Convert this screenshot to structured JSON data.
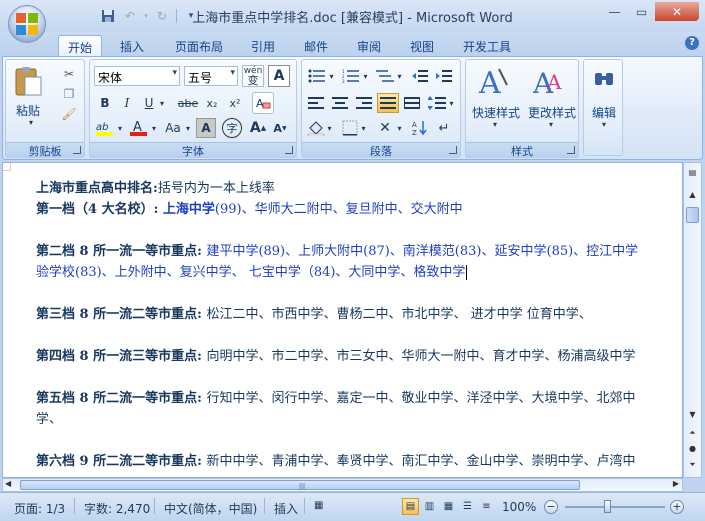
{
  "window": {
    "title": "上海市重点中学排名.doc [兼容模式] - Microsoft Word"
  },
  "tabs": [
    "开始",
    "插入",
    "页面布局",
    "引用",
    "邮件",
    "审阅",
    "视图",
    "开发工具"
  ],
  "ribbon": {
    "clipboard": {
      "group_label": "剪贴板",
      "paste_label": "粘贴"
    },
    "font": {
      "group_label": "字体",
      "font_name": "宋体",
      "font_size": "五号",
      "wen_button": "wén\n变",
      "bold": "B",
      "italic": "I",
      "underline": "U",
      "strikethrough": "abe",
      "subscript": "x₂",
      "superscript": "x²",
      "grow": "A",
      "shrink": "A",
      "char_border": "A",
      "enclose": "字",
      "change_case": "Aa",
      "font_color": "A",
      "highlight": "ab"
    },
    "paragraph": {
      "group_label": "段落"
    },
    "styles": {
      "group_label": "样式",
      "quick_styles": "快速样式",
      "change_styles": "更改样式"
    },
    "editing": {
      "label": "编辑"
    }
  },
  "document": {
    "lines": [
      {
        "parts": [
          {
            "t": "上海市重点高中排名:",
            "s": "bold"
          },
          {
            "t": "括号内为一本上线率",
            "s": "plain"
          }
        ]
      },
      {
        "parts": [
          {
            "t": "第一档（4 大名校）: ",
            "s": "bold"
          },
          {
            "t": "上海中学",
            "s": "blue bold"
          },
          {
            "t": "(99)、华师大二附中、复旦附中、交大附中",
            "s": "blue"
          }
        ]
      },
      {
        "parts": []
      },
      {
        "parts": [
          {
            "t": "第二档 8 所一流一等市重点: ",
            "s": "bold"
          },
          {
            "t": "建平中学(89)、上师大附中(87)、南洋模范(83)、延安中学(85)、控江中学",
            "s": "blue"
          }
        ]
      },
      {
        "parts": [
          {
            "t": "验学校(83)、上外附中、复兴中学、 七宝中学（84)、大同中学、格致中学",
            "s": "blue"
          }
        ]
      },
      {
        "parts": []
      },
      {
        "parts": [
          {
            "t": "第三档 8 所一流二等市重点: ",
            "s": "bold"
          },
          {
            "t": "松江二中、市西中学、曹杨二中、市北中学、 进才中学 位育中学、",
            "s": "plain"
          }
        ]
      },
      {
        "parts": []
      },
      {
        "parts": [
          {
            "t": "第四档 8 所一流三等市重点: ",
            "s": "bold"
          },
          {
            "t": "向明中学、市二中学、市三女中、华师大一附中、育才中学、杨浦高级中学",
            "s": "plain"
          }
        ]
      },
      {
        "parts": []
      },
      {
        "parts": [
          {
            "t": "第五档 8 所二流一等市重点: ",
            "s": "bold"
          },
          {
            "t": "行知中学、闵行中学、嘉定一中、敬业中学、洋泾中学、大境中学、北郊中",
            "s": "plain"
          }
        ]
      },
      {
        "parts": [
          {
            "t": "学、",
            "s": "plain"
          }
        ]
      },
      {
        "parts": []
      },
      {
        "parts": [
          {
            "t": "第六档 9 所二流二等市重点: ",
            "s": "bold"
          },
          {
            "t": "新中中学、青浦中学、奉贤中学、南汇中学、金山中学、崇明中学、卢湾中",
            "s": "plain"
          }
        ]
      }
    ]
  },
  "status": {
    "page": "页面: 1/3",
    "words": "字数: 2,470",
    "language": "中文(简体，中国)",
    "insert_mode": "插入",
    "zoom": "100%"
  }
}
